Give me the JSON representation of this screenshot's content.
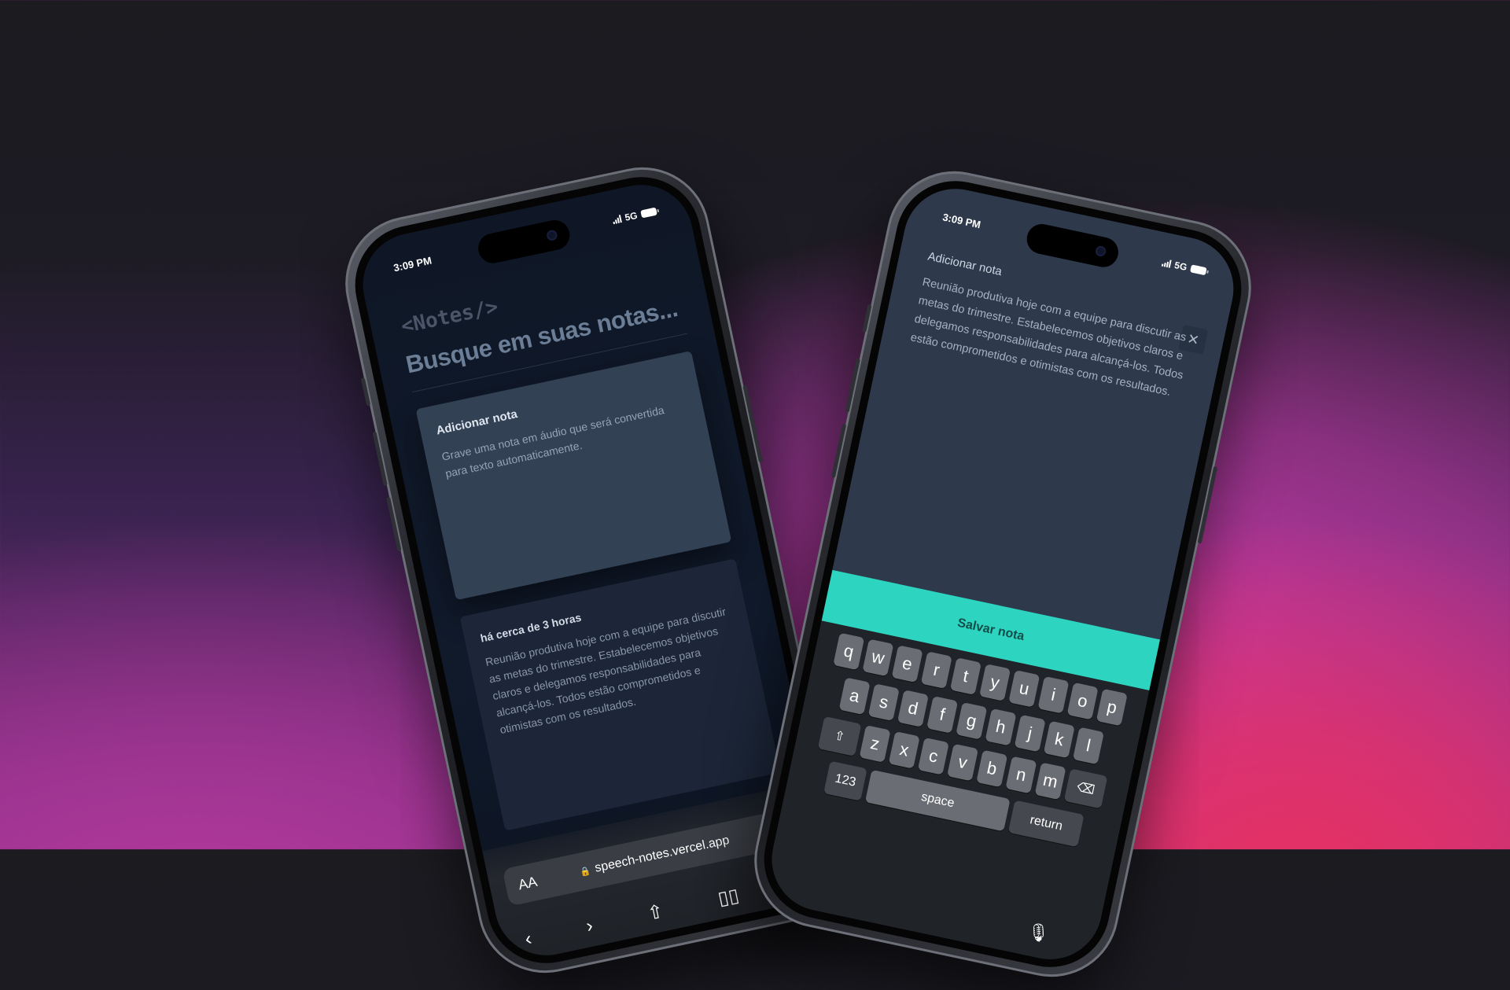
{
  "status": {
    "time": "3:09 PM",
    "network": "5G"
  },
  "app": {
    "logo": "<Notes/>",
    "search_placeholder": "Busque em suas notas...",
    "add_card": {
      "title": "Adicionar nota",
      "description": "Grave uma nota em áudio que será convertida para texto automaticamente."
    },
    "note_card": {
      "time": "há cerca de 3 horas",
      "content": "Reunião produtiva hoje com a equipe para discutir as metas do trimestre. Estabelecemos objetivos claros e delegamos responsabilidades para alcançá-los. Todos estão comprometidos e otimistas com os resultados."
    }
  },
  "browser": {
    "aa": "AA",
    "url": "speech-notes.vercel.app",
    "icons": {
      "reload": "reload-icon",
      "back": "back-icon",
      "forward": "forward-icon",
      "share": "share-icon",
      "bookmarks": "bookmarks-icon",
      "tabs": "tabs-icon"
    }
  },
  "modal": {
    "title": "Adicionar nota",
    "close_label": "✕",
    "text": "Reunião produtiva hoje com a equipe para discutir as metas do trimestre. Estabelecemos objetivos claros e delegamos responsabilidades para alcançá-los. Todos estão comprometidos e otimistas com os resultados.",
    "save_label": "Salvar nota"
  },
  "keyboard": {
    "row1": [
      "q",
      "w",
      "e",
      "r",
      "t",
      "y",
      "u",
      "i",
      "o",
      "p"
    ],
    "row2": [
      "a",
      "s",
      "d",
      "f",
      "g",
      "h",
      "j",
      "k",
      "l"
    ],
    "row3": [
      "z",
      "x",
      "c",
      "v",
      "b",
      "n",
      "m"
    ],
    "numbers_label": "123",
    "space_label": "space",
    "return_label": "return"
  },
  "colors": {
    "accent": "#2dd4bf",
    "card": "#334155",
    "bg": "#0f1726"
  }
}
